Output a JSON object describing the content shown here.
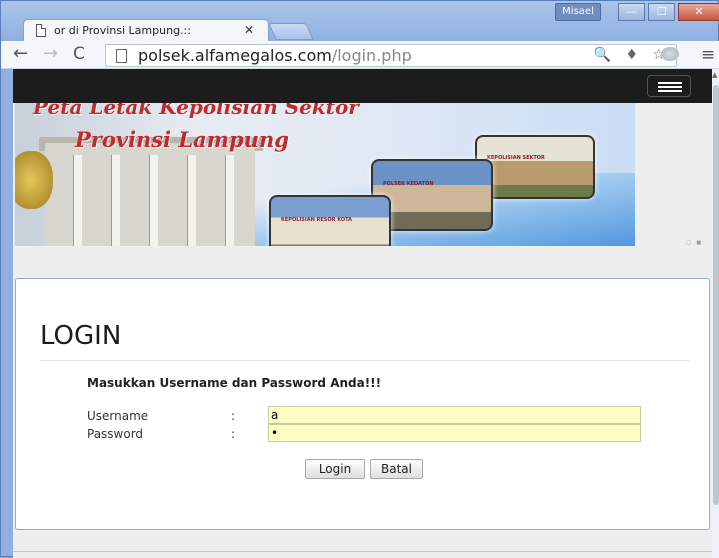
{
  "browser": {
    "tab_title": "or di Provinsi Lampung.::",
    "tab_close": "✕",
    "user_name": "Misael",
    "window_buttons": {
      "minimize": "—",
      "maximize": "☐",
      "close": "✕"
    },
    "url_host": "polsek.alfamegalos.com",
    "url_path": "/login.php",
    "nav": {
      "back": "←",
      "forward": "→",
      "reload": "C"
    },
    "omnibox_icons": "🔍 ♦ ☆",
    "menu_icon": "≡"
  },
  "banner": {
    "headline_line1": "Peta Letak Kepolisian Sektor",
    "headline_line2": "Provinsi Lampung",
    "photo_captions": [
      "KEPOLISIAN SEKTOR",
      "POLSEK KEDATON",
      "KEPOLISIAN RESOR KOTA"
    ],
    "pager": "□ ■"
  },
  "login": {
    "title": "LOGIN",
    "instruction": "Masukkan Username dan Password Anda!!!",
    "username_label": "Username",
    "password_label": "Password",
    "colon": ":",
    "username_value": "a",
    "password_value": "•",
    "login_button": "Login",
    "cancel_button": "Batal"
  },
  "colors": {
    "navbar": "#1c1c1c",
    "field_background": "#fbfdc4",
    "banner_text": "#c4282a",
    "panel_border": "#8fb0d3"
  }
}
